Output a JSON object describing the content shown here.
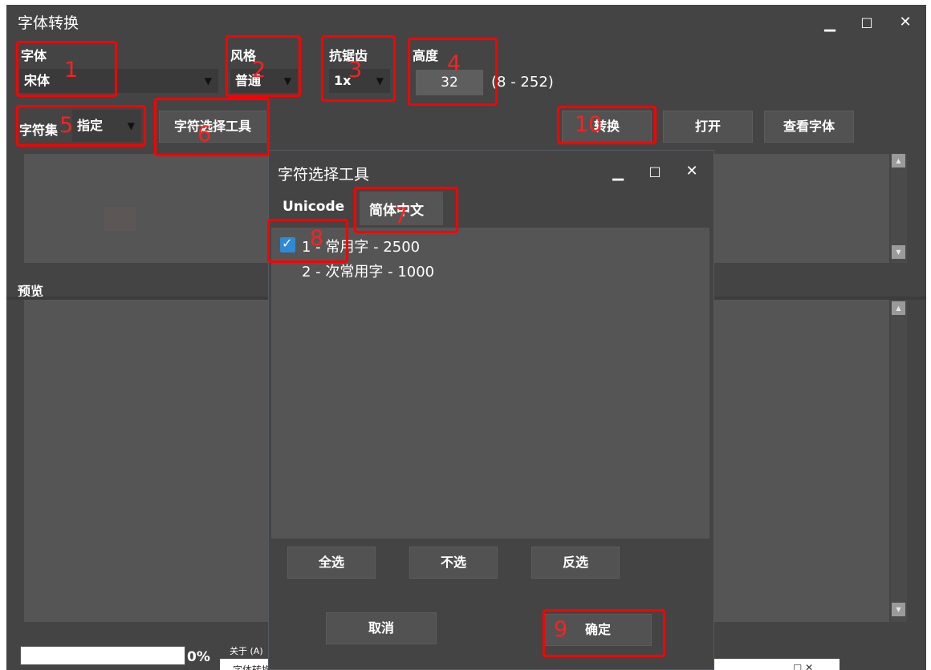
{
  "main": {
    "title": "字体转换",
    "window_controls": {
      "minimize": "▁",
      "maximize": "□",
      "close": "✕"
    },
    "font": {
      "label": "字体",
      "value": "宋体"
    },
    "style": {
      "label": "风格",
      "value": "普通"
    },
    "antialias": {
      "label": "抗锯齿",
      "value": "1x"
    },
    "height": {
      "label": "高度",
      "value": "32",
      "range": "(8 - 252)"
    },
    "charset": {
      "label": "字符集",
      "value": "指定"
    },
    "char_tool_button": "字符选择工具",
    "convert_button": "转换",
    "open_button": "打开",
    "view_font_button": "查看字体",
    "preview_label": "预览",
    "progress": {
      "value": 0,
      "text": "0%"
    },
    "about": "关于 (A)"
  },
  "dialog": {
    "title": "字符选择工具",
    "tabs": [
      {
        "label": "Unicode",
        "active": false
      },
      {
        "label": "简体中文",
        "active": true
      }
    ],
    "items": [
      {
        "label": "1 - 常用字 - 2500",
        "checked": true
      },
      {
        "label": "2 - 次常用字 - 1000",
        "checked": false
      }
    ],
    "select_all": "全选",
    "select_none": "不选",
    "invert": "反选",
    "cancel": "取消",
    "ok": "确定"
  },
  "taskbar_peek": {
    "title": "字体转换",
    "controls": "□ ✕"
  },
  "annotations": [
    "1",
    "2",
    "3",
    "4",
    "5",
    "6",
    "7",
    "8",
    "9",
    "10"
  ],
  "colors": {
    "window_bg": "#444444",
    "panel_bg": "#555555",
    "annotation": "#ff0000",
    "checkbox": "#2d8bd6"
  }
}
